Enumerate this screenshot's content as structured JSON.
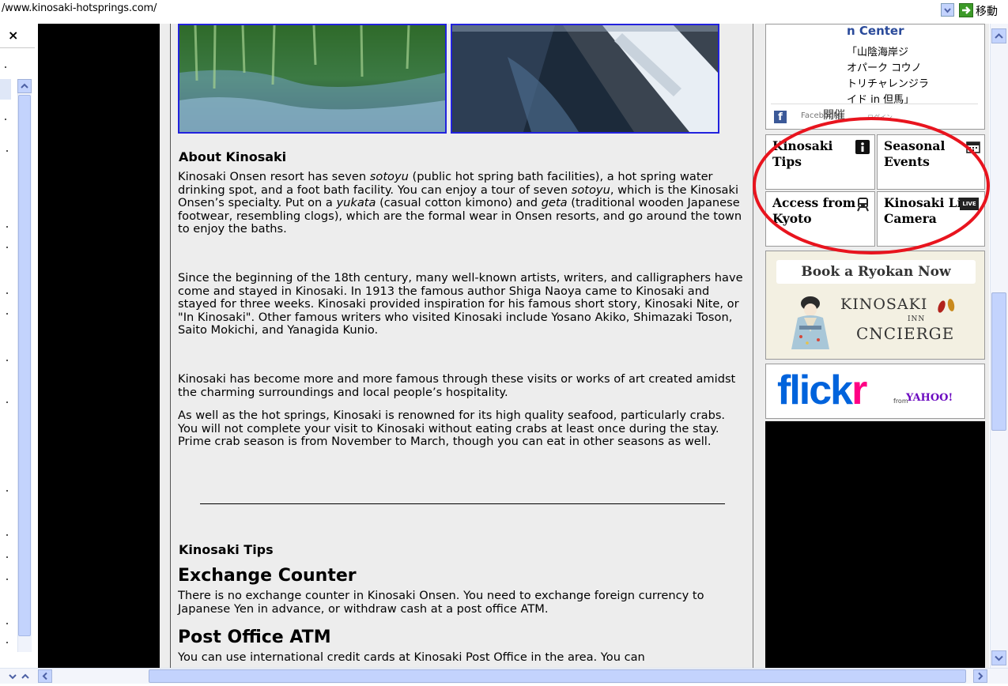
{
  "address_bar": {
    "url": "/www.kinosaki-hotsprings.com/",
    "go_label": "移動"
  },
  "sidebar": {
    "close_label": "×"
  },
  "main": {
    "about": {
      "heading": "About Kinosaki",
      "p1_a": "Kinosaki Onsen resort has seven ",
      "p1_b": "sotoyu",
      "p1_c": " (public hot spring bath facilities), a hot spring water drinking spot, and a foot bath facility. You can enjoy a tour of seven ",
      "p1_d": "sotoyu",
      "p1_e": ", which is the Kinosaki Onsen’s specialty. Put on a ",
      "p1_f": "yukata",
      "p1_g": " (casual cotton kimono) and ",
      "p1_h": "geta",
      "p1_i": " (traditional wooden Japanese footwear, resembling clogs), which are the formal wear in Onsen resorts, and go around the town to enjoy the baths.",
      "p2": "Since the beginning of the 18th century, many well-known artists, writers, and calligraphers have come and stayed in Kinosaki. In 1913 the famous author Shiga Naoya came to Kinosaki and stayed for three weeks. Kinosaki provided inspiration for his famous short story, Kinosaki Nite, or \"In Kinosaki\". Other famous writers who visited Kinosaki include Yosano Akiko, Shimazaki Toson, Saito Mokichi, and Yanagida Kunio.",
      "p3": "Kinosaki has become more and more famous through these visits or works of art created amidst the charming surroundings and local people’s hospitality.",
      "p4": "As well as the hot springs, Kinosaki is renowned for its high quality seafood, particularly crabs. You will not complete your visit to Kinosaki without eating crabs at least once during the stay. Prime crab season is from November to March, though you can eat in other seasons as well."
    },
    "tips": {
      "heading": "Kinosaki Tips",
      "exchange_heading": "Exchange Counter",
      "exchange_text": "There is no exchange counter in Kinosaki Onsen. You need to exchange foreign currency to Japanese Yen in advance, or withdraw cash at a post office ATM.",
      "atm_heading": "Post Office ATM",
      "atm_text": "You can use international credit cards at Kinosaki Post Office in the area. You can"
    }
  },
  "right": {
    "info_box": {
      "heading": "n Center",
      "lines": [
        "「山陰海岸ジ",
        "オパーク コウノ",
        "トリチャレンジラ",
        "イド in 但馬」"
      ],
      "facebook_text": "Facebook",
      "facebook_overlap": "開催 ",
      "facebook_small": "ログイン"
    },
    "tiles": {
      "tips": "Kinosaki Tips",
      "seasonal": "Seasonal Events",
      "access": "Access from Kyoto",
      "camera": "Kinosaki Live Camera",
      "live_badge": "LIVE"
    },
    "ryokan": {
      "button": "Book a Ryokan Now",
      "name": "KINOSAKI",
      "inn": "INN",
      "concierge": "CNCIERGE"
    },
    "flickr": {
      "word_a": "flick",
      "word_b": "r",
      "from": "from",
      "yahoo": "YAHOO!"
    }
  },
  "colors": {
    "annotation_red": "#e8141e",
    "flickr_blue": "#0063dc",
    "flickr_pink": "#ff0084",
    "link_blue": "#2a4a9a"
  }
}
